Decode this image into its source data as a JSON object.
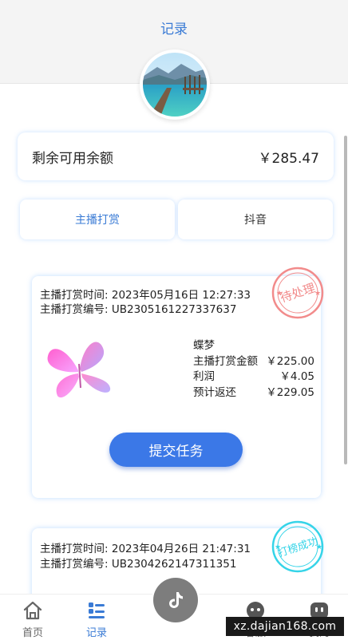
{
  "header": {
    "title": "记录"
  },
  "avatar": {
    "alt": "user-avatar"
  },
  "balance": {
    "label": "剩余可用余额",
    "value": "￥285.47"
  },
  "tabs": [
    {
      "label": "主播打赏",
      "active": true
    },
    {
      "label": "抖音",
      "active": false
    }
  ],
  "orders": [
    {
      "time_label": "主播打赏时间:",
      "time": "2023年05月16日 12:27:33",
      "no_label": "主播打赏编号:",
      "no": "UB2305161227337637",
      "stamp": "待处理",
      "gift_name": "蝶梦",
      "amount_label": "主播打赏金额",
      "amount": "￥225.00",
      "profit_label": "利润",
      "profit": "￥4.05",
      "refund_label": "预计返还",
      "refund": "￥229.05",
      "button": "提交任务"
    },
    {
      "time_label": "主播打赏时间:",
      "time": "2023年04月26日 21:47:31",
      "no_label": "主播打赏编号:",
      "no": "UB2304262147311351",
      "stamp": "打榜成功"
    }
  ],
  "tabbar": {
    "home": "首页",
    "records": "记录",
    "service": "客服",
    "mine": "我的"
  },
  "watermark": "xz.dajian168.com",
  "colors": {
    "accent": "#3a7bd5",
    "button": "#3b78e7",
    "stamp_pending": "#f28b8b",
    "stamp_success": "#35d4e8"
  }
}
